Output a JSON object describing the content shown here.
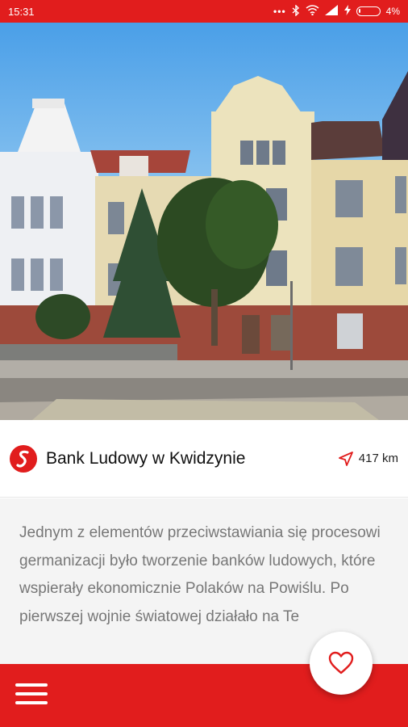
{
  "status_bar": {
    "time": "15:31",
    "battery_percent": "4%",
    "icons": [
      "dots-icon",
      "bluetooth-icon",
      "wifi-icon",
      "signal-icon",
      "charging-icon",
      "battery-icon"
    ]
  },
  "hero": {
    "image": "photo-of-bank-building"
  },
  "place": {
    "title": "Bank Ludowy w Kwidzynie",
    "distance": "417 km",
    "logo_icon": "brand-s-icon",
    "distance_icon": "navigation-arrow-icon"
  },
  "description": {
    "text": "Jednym z elementów przeciwstawiania się procesowi germanizacji było tworzenie banków ludowych, które wspierały ekonomicznie Polaków na Powiślu. Po pierwszej wojnie światowej działało na Te"
  },
  "bottom_bar": {
    "menu_icon": "hamburger-menu-icon",
    "favorite_icon": "heart-icon"
  },
  "colors": {
    "accent": "#e11d1d",
    "text_dark": "#111111",
    "text_muted": "#777777",
    "description_bg": "#f4f4f4"
  }
}
